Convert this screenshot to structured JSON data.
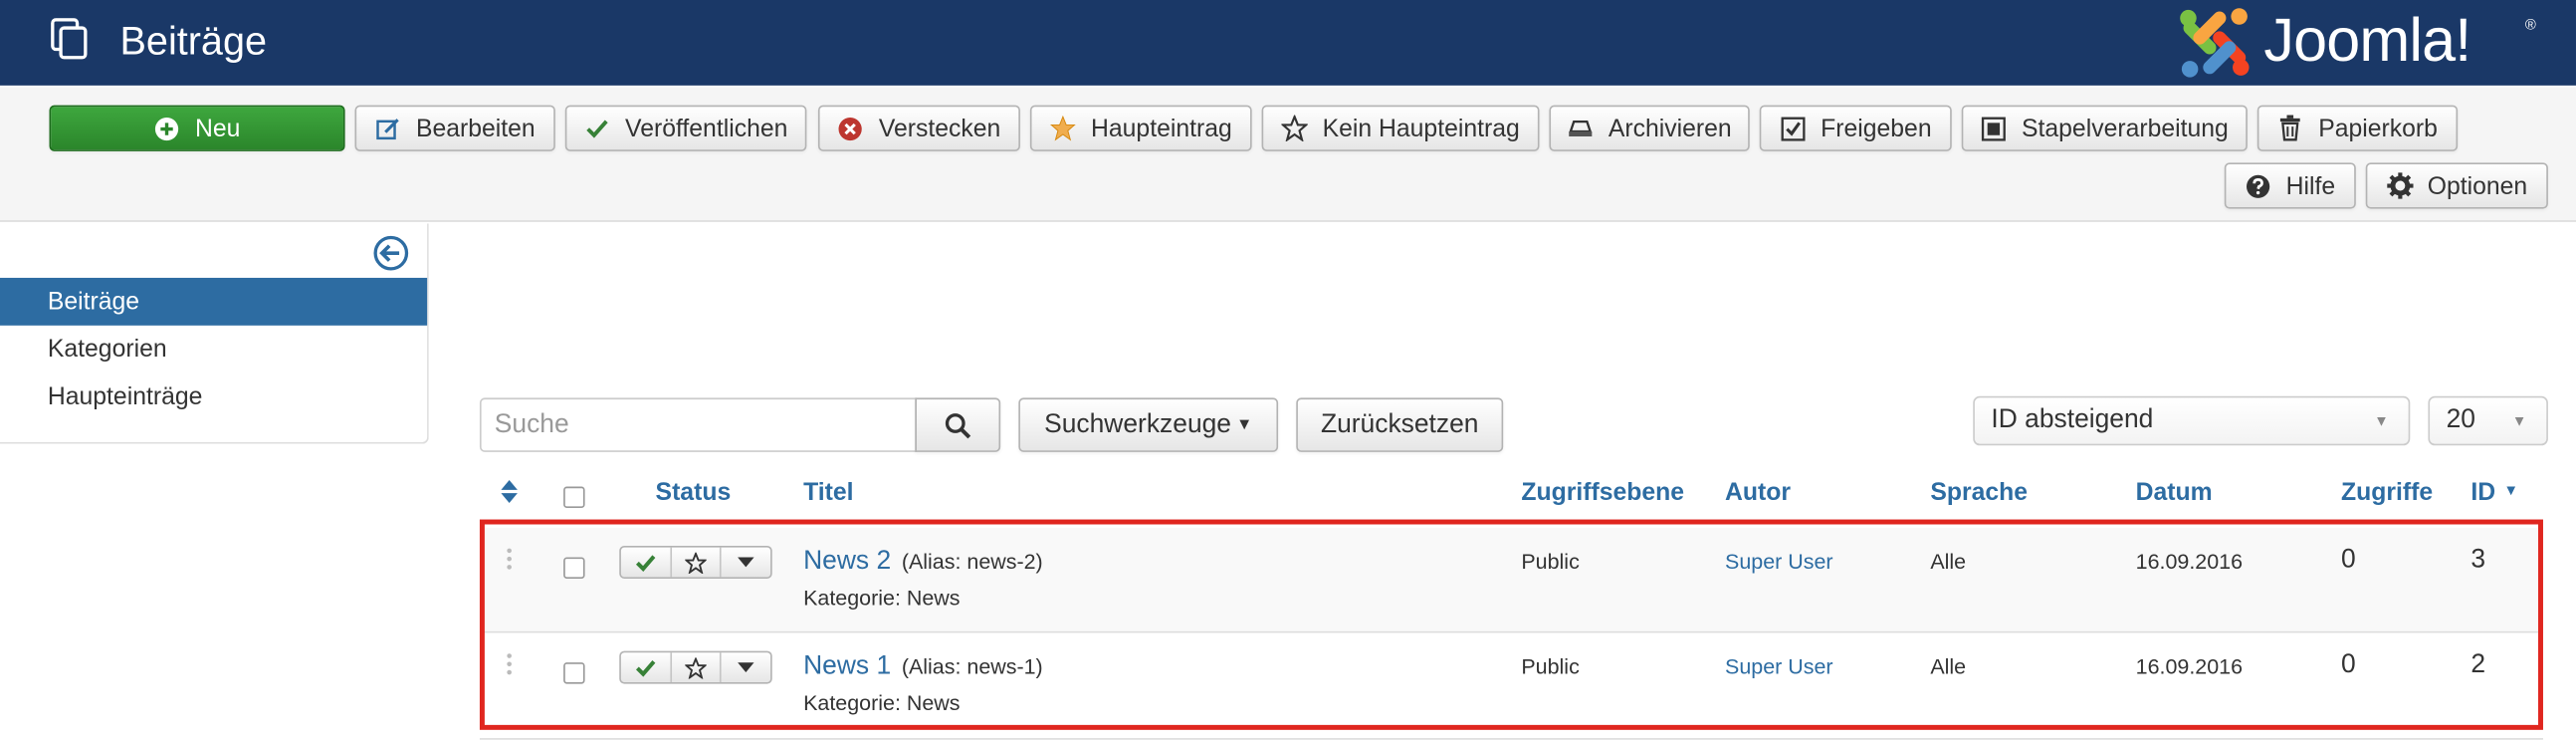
{
  "header": {
    "title": "Beiträge",
    "logo_text": "Joomla!",
    "logo_reg": "®",
    "bg_color": "#1a3867"
  },
  "toolbar": {
    "buttons": [
      {
        "label": "Neu",
        "icon": "plus-circle-icon"
      },
      {
        "label": "Bearbeiten",
        "icon": "edit-icon"
      },
      {
        "label": "Veröffentlichen",
        "icon": "check-icon"
      },
      {
        "label": "Verstecken",
        "icon": "x-circle-icon"
      },
      {
        "label": "Haupteintrag",
        "icon": "star-filled-icon"
      },
      {
        "label": "Kein Haupteintrag",
        "icon": "star-outline-icon"
      },
      {
        "label": "Archivieren",
        "icon": "archive-icon"
      },
      {
        "label": "Freigeben",
        "icon": "checkbox-icon"
      },
      {
        "label": "Stapelverarbeitung",
        "icon": "square-icon"
      },
      {
        "label": "Papierkorb",
        "icon": "trash-icon"
      },
      {
        "label": "Hilfe",
        "icon": "question-icon"
      },
      {
        "label": "Optionen",
        "icon": "gear-icon"
      }
    ]
  },
  "sidebar": {
    "items": [
      {
        "label": "Beiträge",
        "active": true
      },
      {
        "label": "Kategorien",
        "active": false
      },
      {
        "label": "Haupteinträge",
        "active": false
      }
    ]
  },
  "filters": {
    "search_placeholder": "Suche",
    "search_tools_label": "Suchwerkzeuge",
    "reset_label": "Zurücksetzen",
    "ordering_value": "ID absteigend",
    "limit_value": "20"
  },
  "table": {
    "columns": [
      "Status",
      "Titel",
      "Zugriffsebene",
      "Autor",
      "Sprache",
      "Datum",
      "Zugriffe",
      "ID"
    ],
    "rows": [
      {
        "title": "News 2",
        "alias": "(Alias: news-2)",
        "category": "Kategorie: News",
        "access": "Public",
        "author": "Super User",
        "language": "Alle",
        "date": "16.09.2016",
        "hits": "0",
        "id": "3"
      },
      {
        "title": "News 1",
        "alias": "(Alias: news-1)",
        "category": "Kategorie: News",
        "access": "Public",
        "author": "Super User",
        "language": "Alle",
        "date": "16.09.2016",
        "hits": "0",
        "id": "2"
      }
    ]
  },
  "colors": {
    "accent": "#2d6ca2",
    "success": "#2b862b",
    "highlight": "#e0261f"
  }
}
